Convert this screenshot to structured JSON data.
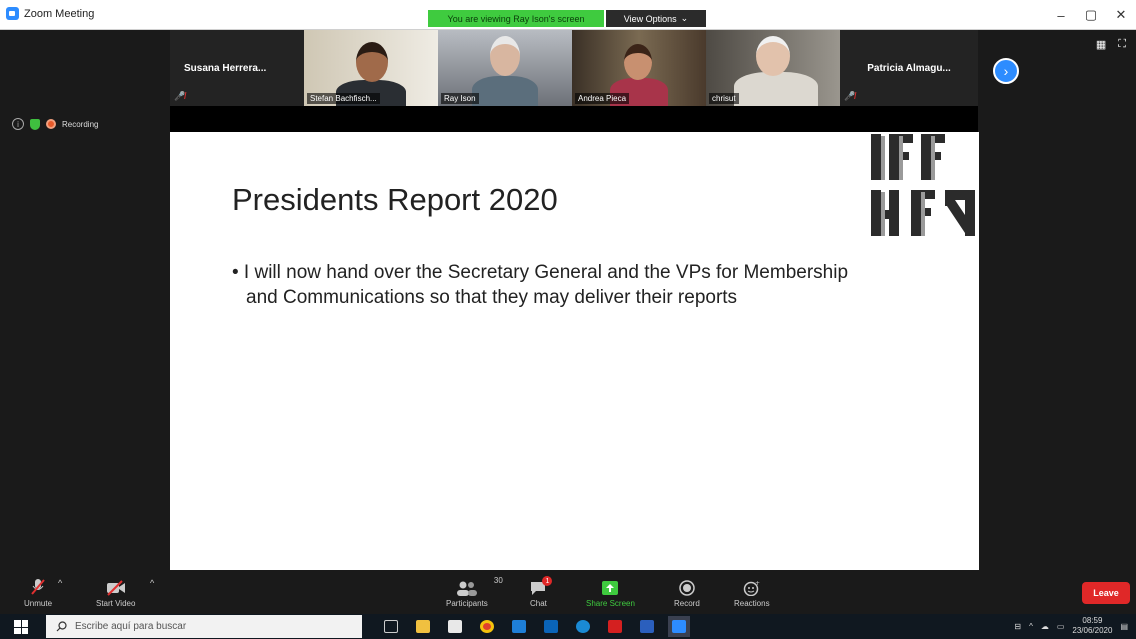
{
  "window": {
    "title": "Zoom Meeting",
    "controls": [
      "–",
      "▢",
      "✕"
    ]
  },
  "banner": {
    "viewing_text": "You are viewing Ray Ison's screen",
    "view_options_label": "View Options",
    "view_options_arrow": "⌄"
  },
  "gallery": {
    "participants": [
      {
        "name": "Susana  Herrera...",
        "video": false
      },
      {
        "name": "Stefan Bachfisch...",
        "video": true
      },
      {
        "name": "Ray Ison",
        "video": true
      },
      {
        "name": "Andrea Pieca",
        "video": true
      },
      {
        "name": "chrisut",
        "video": true
      },
      {
        "name": "Patricia  Almagu...",
        "video": false
      }
    ],
    "next_page_icon": "chevron-right-icon"
  },
  "status": {
    "recording_label": "Recording"
  },
  "slide": {
    "title": "Presidents Report 2020",
    "bullet": "• I will now hand over the Secretary General and the VPs for Membership and Communications so that they may deliver their reports",
    "logo_text": "IFFR"
  },
  "toolbar": {
    "unmute_label": "Unmute",
    "start_video_label": "Start Video",
    "participants_label": "Participants",
    "participants_count": "30",
    "chat_label": "Chat",
    "chat_badge": "1",
    "share_label": "Share Screen",
    "record_label": "Record",
    "reactions_label": "Reactions",
    "leave_label": "Leave",
    "accent": "#2d8cff",
    "share_color": "#3fcb3f",
    "leave_color": "#e02828"
  },
  "taskbar": {
    "search_placeholder": "Escribe aquí para buscar",
    "time": "08:59",
    "date": "23/06/2020"
  }
}
